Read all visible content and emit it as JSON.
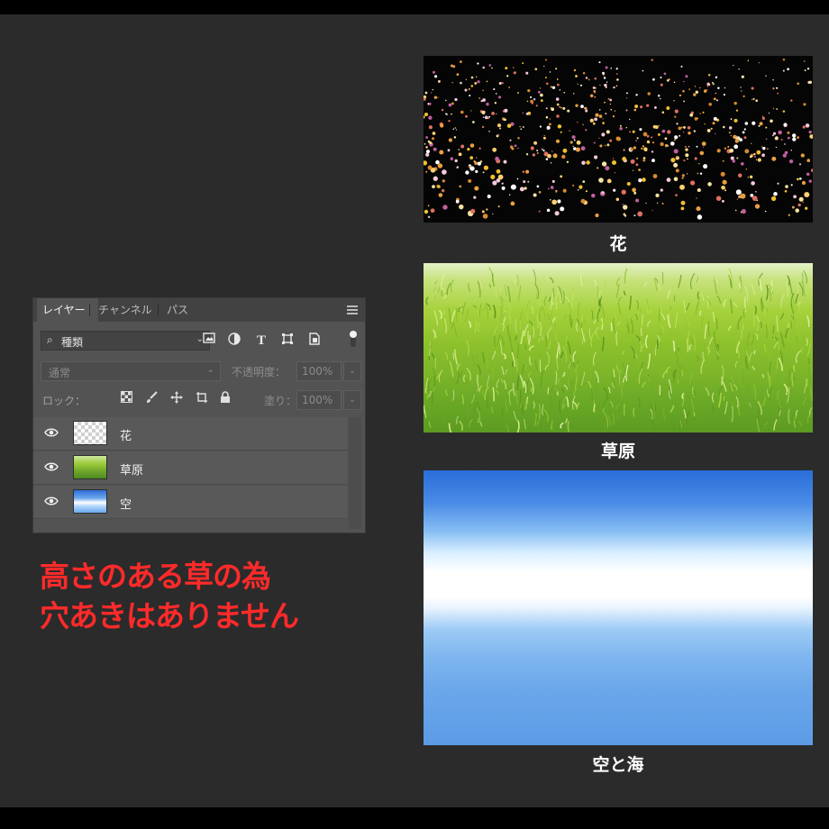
{
  "layers_panel": {
    "tabs": [
      "レイヤー",
      "チャンネル",
      "パス"
    ],
    "filter": {
      "label": "種類"
    },
    "blend_mode": "通常",
    "opacity_label": "不透明度：",
    "opacity_value": "100%",
    "lock_label": "ロック：",
    "fill_label": "塗り：",
    "fill_value": "100%",
    "layers": [
      {
        "name": "花",
        "thumb": "transparent-checker"
      },
      {
        "name": "草原",
        "thumb": "grass"
      },
      {
        "name": "空",
        "thumb": "sky"
      }
    ]
  },
  "note": {
    "line1": "高さのある草の為",
    "line2": "穴あきはありません",
    "color": "#ff2a2a"
  },
  "images": [
    {
      "caption": "花"
    },
    {
      "caption": "草原"
    },
    {
      "caption": "空と海"
    }
  ]
}
